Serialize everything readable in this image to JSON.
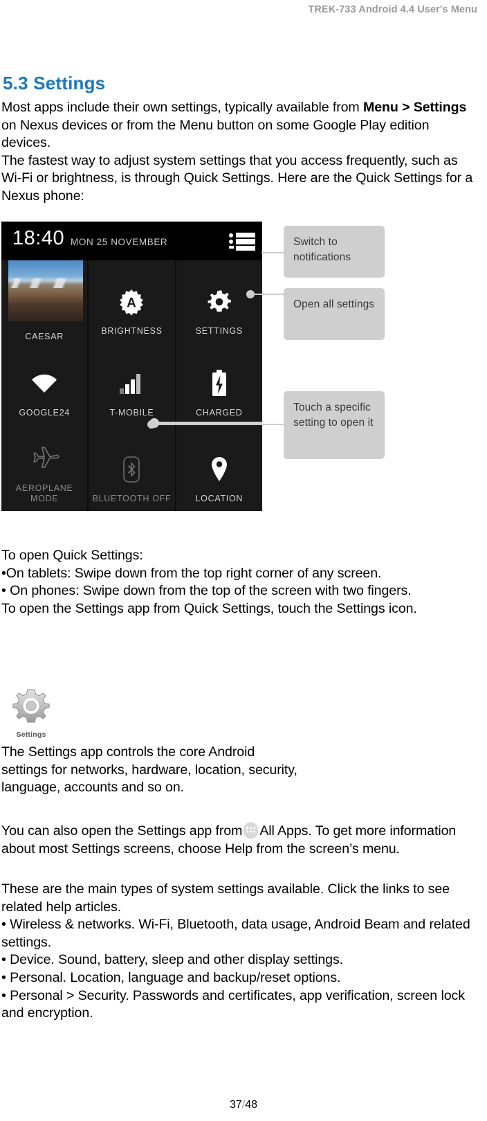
{
  "header": {
    "running_title": "TREK-733 Android 4.4 User's Menu"
  },
  "section": {
    "number_title": "5.3 Settings",
    "heading_color": "#1c78c0"
  },
  "intro": {
    "line1_a": "Most apps include their own settings, typically available from ",
    "line1_bold": "Menu > Settings",
    "line1_b": " on Nexus devices or from the Menu button on some Google Play edition devices.",
    "line2": "The fastest way to adjust system settings that you access frequently, such as Wi-Fi or brightness, is through Quick Settings. Here are the Quick Settings for a Nexus phone:"
  },
  "figure": {
    "statusbar": {
      "time": "18:40",
      "date": "MON 25 NOVEMBER",
      "notifications_icon": "notification-list-icon"
    },
    "tiles": [
      {
        "label": "CAESAR",
        "icon": "user-photo-icon",
        "dimmed": false
      },
      {
        "label": "BRIGHTNESS",
        "icon": "brightness-auto-icon",
        "dimmed": false
      },
      {
        "label": "SETTINGS",
        "icon": "gear-icon",
        "dimmed": false
      },
      {
        "label": "GOOGLE24",
        "icon": "wifi-icon",
        "dimmed": false
      },
      {
        "label": "T-MOBILE",
        "icon": "signal-bars-icon",
        "dimmed": false
      },
      {
        "label": "CHARGED",
        "icon": "battery-charging-icon",
        "dimmed": false
      },
      {
        "label": "AEROPLANE MODE",
        "icon": "airplane-icon",
        "dimmed": true
      },
      {
        "label": "BLUETOOTH OFF",
        "icon": "bluetooth-icon",
        "dimmed": true
      },
      {
        "label": "LOCATION",
        "icon": "location-pin-icon",
        "dimmed": false
      }
    ],
    "callouts": [
      {
        "text": "Switch to notifications"
      },
      {
        "text": "Open all settings"
      },
      {
        "text": "Touch a specific setting to open it"
      }
    ]
  },
  "open_quick_settings": {
    "lead": "To open Quick Settings:",
    "bullet1": "•On tablets: Swipe down from the top right corner of any screen.",
    "bullet2": "• On phones: Swipe down from the top of the screen with two fingers.",
    "closing": "To open the Settings app from Quick Settings, touch the Settings icon."
  },
  "settings_icon": {
    "label": "Settings",
    "icon": "gear-icon"
  },
  "core_paragraph": {
    "line1": "The Settings app controls the core Android",
    "line2": "settings for networks, hardware, location, security,",
    "line3": "language, accounts and so on."
  },
  "all_apps_paragraph": {
    "before_icon": "You can also open the Settings app from",
    "icon": "all-apps-icon",
    "after_icon": "All Apps. To get more information about most Settings screens, choose Help from the screen’s menu."
  },
  "settings_types": {
    "intro": "These are the main types of system settings available. Click the links to see related help articles.",
    "items": [
      "• Wireless & networks. Wi-Fi, Bluetooth, data usage, Android Beam and related settings.",
      "• Device. Sound, battery, sleep and other display settings.",
      "• Personal. Location, language and backup/reset options.",
      "•  Personal > Security. Passwords and certificates, app verification, screen lock and encryption."
    ]
  },
  "footer": {
    "current_page": "37",
    "separator": "/",
    "total_pages": "48"
  }
}
